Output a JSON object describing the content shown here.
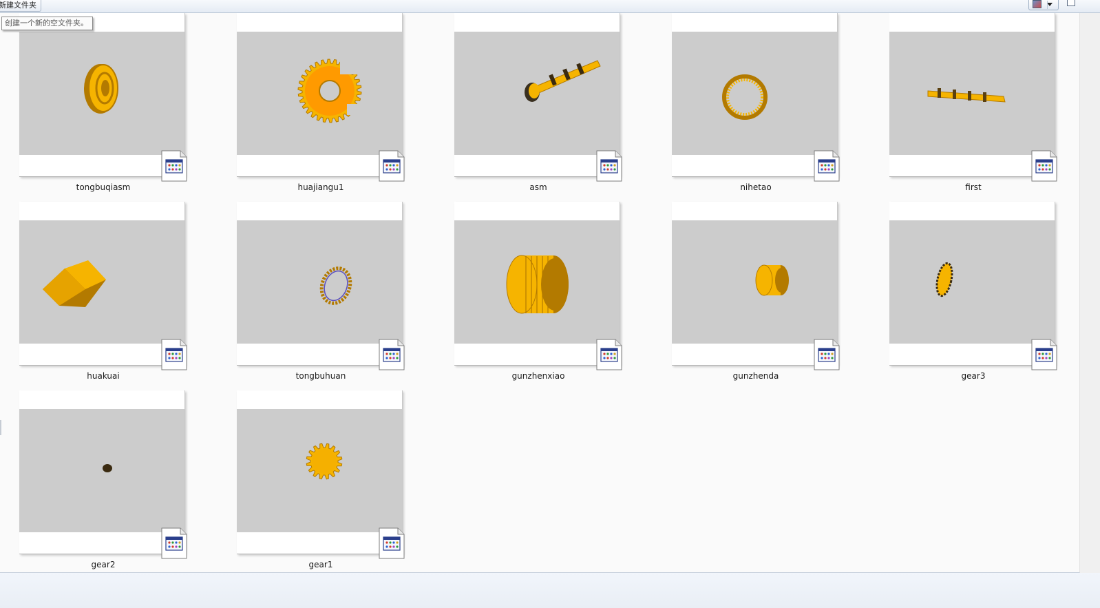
{
  "toolbar": {
    "new_folder_label": "新建文件夹",
    "view_button_icon": "change-view-icon",
    "preview_pane_icon": "preview-pane-icon"
  },
  "tooltip": {
    "text": "创建一个新的空文件夹。"
  },
  "files": [
    {
      "name": "tongbuqiasm",
      "part": "synchronizer-assembly"
    },
    {
      "name": "huajiangu1",
      "part": "notched-gear-hub"
    },
    {
      "name": "asm",
      "part": "shaft-assembly"
    },
    {
      "name": "nihetao",
      "part": "engagement-sleeve"
    },
    {
      "name": "first",
      "part": "long-shaft"
    },
    {
      "name": "huakuai",
      "part": "slider-block"
    },
    {
      "name": "tongbuhuan",
      "part": "synchronizer-ring"
    },
    {
      "name": "gunzhenxiao",
      "part": "large-needle-bearing"
    },
    {
      "name": "gunzhenda",
      "part": "small-needle-bearing"
    },
    {
      "name": "gear3",
      "part": "gear-edge-on"
    },
    {
      "name": "gear2",
      "part": "tiny-gear"
    },
    {
      "name": "gear1",
      "part": "spur-gear"
    }
  ],
  "colors": {
    "part_fill": "#f6b400",
    "part_dark": "#b37a00",
    "viewport_bg": "#cccccc",
    "content_bg": "#fafafa"
  },
  "icons": {
    "file_type": "catia-document-icon"
  }
}
